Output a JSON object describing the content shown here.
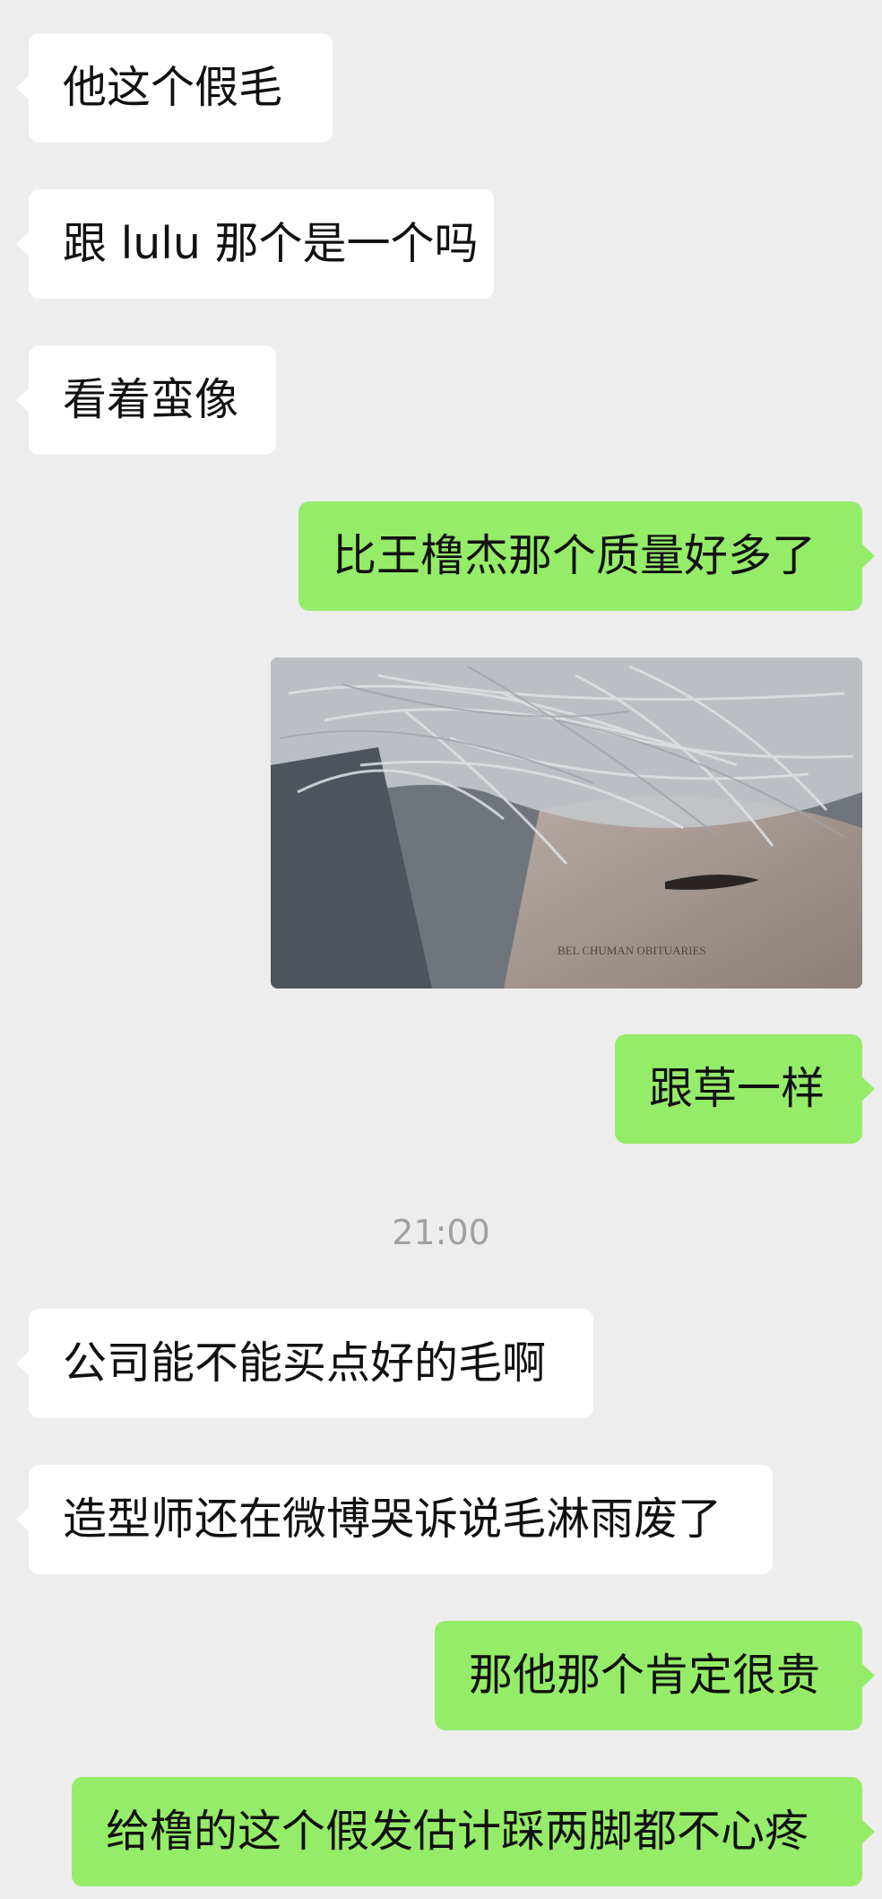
{
  "messages": [
    {
      "side": "left",
      "text": "他这个假毛"
    },
    {
      "side": "left",
      "text": "跟 lulu 那个是一个吗"
    },
    {
      "side": "left",
      "text": "看着蛮像"
    },
    {
      "side": "right",
      "text": "比王橹杰那个质量好多了"
    },
    {
      "side": "right",
      "type": "image",
      "caption": "BEL CHUMAN OBITUARIES"
    },
    {
      "side": "right",
      "text": "跟草一样"
    },
    {
      "type": "time",
      "text": "21:00"
    },
    {
      "side": "left",
      "text": "公司能不能买点好的毛啊"
    },
    {
      "side": "left",
      "text": "造型师还在微博哭诉说毛淋雨废了"
    },
    {
      "side": "right",
      "text": "那他那个肯定很贵"
    },
    {
      "side": "right",
      "text": "给橹的这个假发估计踩两脚都不心疼"
    }
  ],
  "colors": {
    "background": "#ededed",
    "left_bubble": "#ffffff",
    "right_bubble": "#95ec69",
    "timestamp": "#a0a0a0"
  }
}
